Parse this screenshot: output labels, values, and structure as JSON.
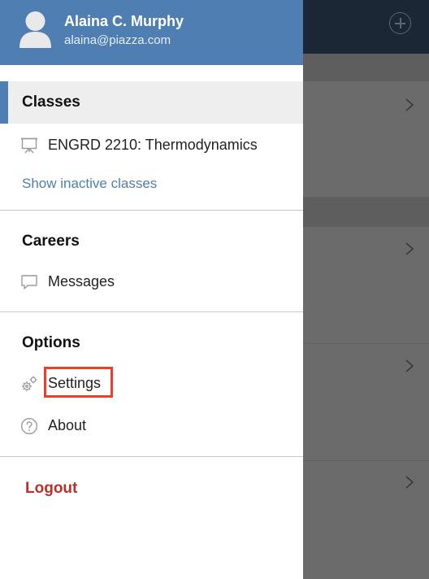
{
  "user": {
    "name": "Alaina C. Murphy",
    "email": "alaina@piazza.com"
  },
  "classes": {
    "title": "Classes",
    "items": [
      {
        "label": "ENGRD 2210: Thermodynamics",
        "icon": "presentation-board-icon"
      }
    ],
    "show_inactive_label": "Show inactive classes"
  },
  "careers": {
    "title": "Careers",
    "items": [
      {
        "label": "Messages",
        "icon": "message-bubble-icon"
      }
    ]
  },
  "options": {
    "title": "Options",
    "items": [
      {
        "label": "Settings",
        "icon": "gears-icon",
        "highlighted": true
      },
      {
        "label": "About",
        "icon": "question-circle-icon"
      }
    ]
  },
  "logout_label": "Logout",
  "colors": {
    "header_bg": "#4f7eb3",
    "accent": "#4f7eb3",
    "link": "#4f7eb3",
    "logout": "#b8322a",
    "highlight_box": "#e8402a",
    "background_topbar": "#1b2735",
    "overlay": "#6b6b6b"
  }
}
